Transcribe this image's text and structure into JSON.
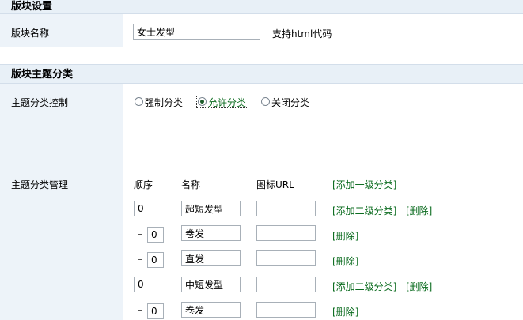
{
  "board_settings": {
    "title": "版块设置",
    "name_label": "版块名称",
    "name_value": "女士发型",
    "name_hint": "支持html代码"
  },
  "topic_section": {
    "title": "版块主题分类",
    "control_label": "主题分类控制",
    "options": [
      {
        "label": "强制分类",
        "checked": false
      },
      {
        "label": "允许分类",
        "checked": true
      },
      {
        "label": "关闭分类",
        "checked": false
      }
    ],
    "manage_label": "主题分类管理",
    "col_order": "顺序",
    "col_name": "名称",
    "col_icon": "图标URL",
    "add_top_level": "[添加一级分类]",
    "add_sub": "[添加二级分类]",
    "delete": "[删除]",
    "rows": [
      {
        "level": 1,
        "order": "0",
        "name": "超短发型",
        "icon_url": ""
      },
      {
        "level": 2,
        "order": "0",
        "name": "卷发",
        "icon_url": ""
      },
      {
        "level": 2,
        "order": "0",
        "name": "直发",
        "icon_url": ""
      },
      {
        "level": 1,
        "order": "0",
        "name": "中短发型",
        "icon_url": ""
      },
      {
        "level": 2,
        "order": "0",
        "name": "卷发",
        "icon_url": ""
      }
    ]
  }
}
